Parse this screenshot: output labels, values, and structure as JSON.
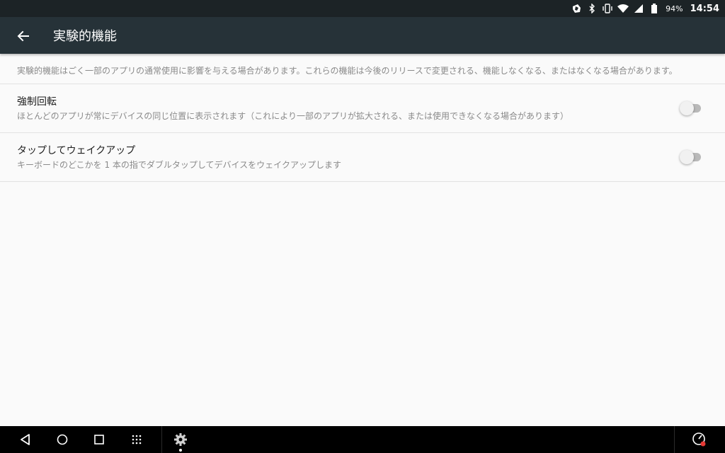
{
  "status_bar": {
    "battery_percent": "94%",
    "time": "14:54",
    "icons": [
      "notification-icon",
      "bluetooth-icon",
      "vibrate-icon",
      "wifi-icon",
      "signal-icon",
      "battery-icon"
    ]
  },
  "toolbar": {
    "back_icon": "arrow-back-icon",
    "title": "実験的機能"
  },
  "description": "実験的機能はごく一部のアプリの通常使用に影響を与える場合があります。これらの機能は今後のリリースで変更される、機能しなくなる、またはなくなる場合があります。",
  "preferences": [
    {
      "title": "強制回転",
      "summary": "ほとんどのアプリが常にデバイスの同じ位置に表示されます（これにより一部のアプリが拡大される、または使用できなくなる場合があります）",
      "enabled": false
    },
    {
      "title": "タップしてウェイクアップ",
      "summary": "キーボードのどこかを 1 本の指でダブルタップしてデバイスをウェイクアップします",
      "enabled": false
    }
  ],
  "nav_bar": {
    "buttons": [
      "back-icon",
      "home-icon",
      "recents-icon",
      "app-drawer-icon",
      "settings-gear-icon",
      "speedometer-icon"
    ]
  },
  "colors": {
    "status_bar": "#1c2326",
    "toolbar": "#263238",
    "background": "#fafafa",
    "switch_off_track": "#b9b9b9",
    "switch_off_thumb": "#f1f1f1"
  }
}
